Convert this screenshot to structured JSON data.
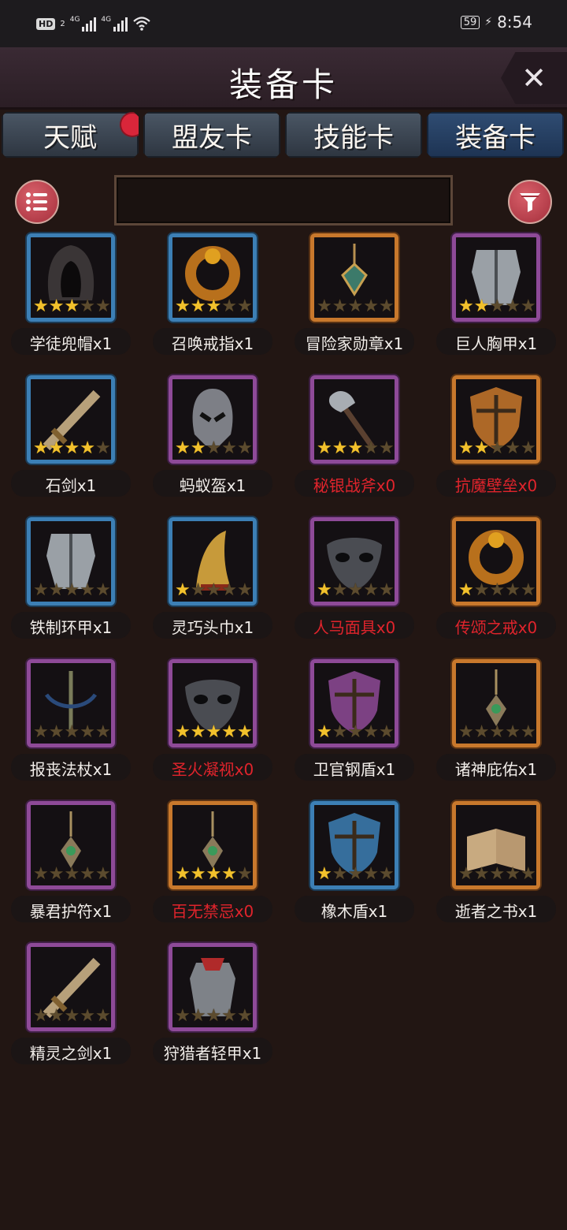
{
  "status": {
    "hd": "HD",
    "sim_sub": "2",
    "network1": "4G",
    "network2": "4G",
    "battery": "59",
    "time": "8:54"
  },
  "header": {
    "title": "装备卡",
    "close_icon": "close-icon"
  },
  "tabs": [
    {
      "label": "天赋",
      "active": false,
      "badge": true
    },
    {
      "label": "盟友卡",
      "active": false,
      "badge": false
    },
    {
      "label": "技能卡",
      "active": false,
      "badge": false
    },
    {
      "label": "装备卡",
      "active": true,
      "badge": false
    }
  ],
  "toolbar": {
    "list_icon": "list-icon",
    "filter_icon": "filter-icon",
    "search_value": ""
  },
  "colors": {
    "blue": "#3c7fb5",
    "purple": "#8e4a98",
    "orange": "#c8782c",
    "zero_text": "#e0242c",
    "star": "#f2c12c"
  },
  "items": [
    {
      "name": "学徒兜帽",
      "count": "x1",
      "rarity": "blue",
      "stars": 3,
      "art": "hood-icon"
    },
    {
      "name": "召唤戒指",
      "count": "x1",
      "rarity": "blue",
      "stars": 3,
      "art": "ring-icon"
    },
    {
      "name": "冒险家勋章",
      "count": "x1",
      "rarity": "orange",
      "stars": 0,
      "art": "medal-icon"
    },
    {
      "name": "巨人胸甲",
      "count": "x1",
      "rarity": "purple",
      "stars": 2,
      "art": "chestplate-icon"
    },
    {
      "name": "石剑",
      "count": "x1",
      "rarity": "blue",
      "stars": 4,
      "art": "sword-icon"
    },
    {
      "name": "蚂蚁盔",
      "count": "x1",
      "rarity": "purple",
      "stars": 2,
      "art": "helmet-icon"
    },
    {
      "name": "秘银战斧",
      "count": "x0",
      "rarity": "purple",
      "stars": 3,
      "art": "axe-icon"
    },
    {
      "name": "抗魔壁垒",
      "count": "x0",
      "rarity": "orange",
      "stars": 2,
      "art": "shield-icon"
    },
    {
      "name": "铁制环甲",
      "count": "x1",
      "rarity": "blue",
      "stars": 0,
      "art": "chestplate-icon"
    },
    {
      "name": "灵巧头巾",
      "count": "x1",
      "rarity": "blue",
      "stars": 1,
      "art": "hat-icon"
    },
    {
      "name": "人马面具",
      "count": "x0",
      "rarity": "purple",
      "stars": 1,
      "art": "mask-icon"
    },
    {
      "name": "传颂之戒",
      "count": "x0",
      "rarity": "orange",
      "stars": 1,
      "art": "ring-icon"
    },
    {
      "name": "报丧法杖",
      "count": "x1",
      "rarity": "purple",
      "stars": 0,
      "art": "staff-icon"
    },
    {
      "name": "圣火凝视",
      "count": "x0",
      "rarity": "purple",
      "stars": 5,
      "art": "mask-icon"
    },
    {
      "name": "卫官钢盾",
      "count": "x1",
      "rarity": "purple",
      "stars": 1,
      "art": "shield-icon"
    },
    {
      "name": "诸神庇佑",
      "count": "x1",
      "rarity": "orange",
      "stars": 0,
      "art": "amulet-icon"
    },
    {
      "name": "暴君护符",
      "count": "x1",
      "rarity": "purple",
      "stars": 0,
      "art": "amulet-icon"
    },
    {
      "name": "百无禁忌",
      "count": "x0",
      "rarity": "orange",
      "stars": 4,
      "art": "amulet-icon"
    },
    {
      "name": "橡木盾",
      "count": "x1",
      "rarity": "blue",
      "stars": 1,
      "art": "shield-icon"
    },
    {
      "name": "逝者之书",
      "count": "x1",
      "rarity": "orange",
      "stars": 0,
      "art": "book-icon"
    },
    {
      "name": "精灵之剑",
      "count": "x1",
      "rarity": "purple",
      "stars": 0,
      "art": "sword-icon"
    },
    {
      "name": "狩猎者轻甲",
      "count": "x1",
      "rarity": "purple",
      "stars": 0,
      "art": "armor-icon"
    }
  ]
}
